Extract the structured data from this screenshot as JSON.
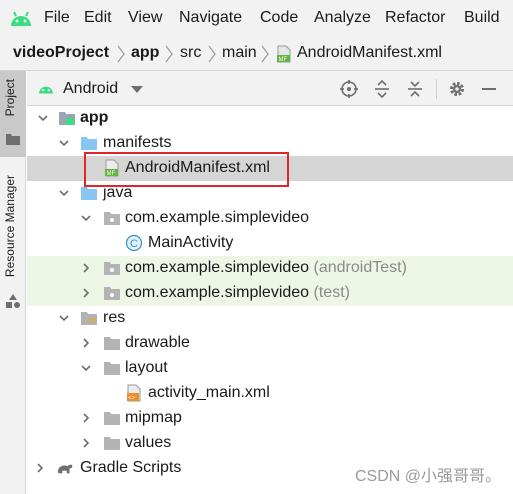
{
  "menu": [
    "File",
    "Edit",
    "View",
    "Navigate",
    "Code",
    "Analyze",
    "Refactor",
    "Build"
  ],
  "breadcrumb": [
    "videoProject",
    "app",
    "src",
    "main",
    "AndroidManifest.xml"
  ],
  "side_tabs": {
    "project": "Project",
    "resource_manager": "Resource Manager"
  },
  "tool_window": {
    "view_selector": "Android"
  },
  "tree": [
    {
      "label": "app"
    },
    {
      "label": "manifests"
    },
    {
      "label": "AndroidManifest.xml"
    },
    {
      "label": "java"
    },
    {
      "label": "com.example.simplevideo"
    },
    {
      "label": "MainActivity"
    },
    {
      "label": "com.example.simplevideo",
      "suffix": "(androidTest)"
    },
    {
      "label": "com.example.simplevideo",
      "suffix": "(test)"
    },
    {
      "label": "res"
    },
    {
      "label": "drawable"
    },
    {
      "label": "layout"
    },
    {
      "label": "activity_main.xml"
    },
    {
      "label": "mipmap"
    },
    {
      "label": "values"
    },
    {
      "label": "Gradle Scripts"
    }
  ],
  "watermark": "CSDN @小强哥哥。",
  "colors": {
    "highlight": "#e0262b",
    "folder": "#88c6f2",
    "test_row": "#eef7e6"
  },
  "icons": [
    "android-logo-icon",
    "folder-icon",
    "manifest-file-icon",
    "java-class-icon",
    "package-icon",
    "res-folder-icon",
    "layout-xml-icon",
    "gradle-icon",
    "crosshair-icon",
    "expand-all-icon",
    "collapse-all-icon",
    "gear-icon",
    "minimize-icon"
  ]
}
